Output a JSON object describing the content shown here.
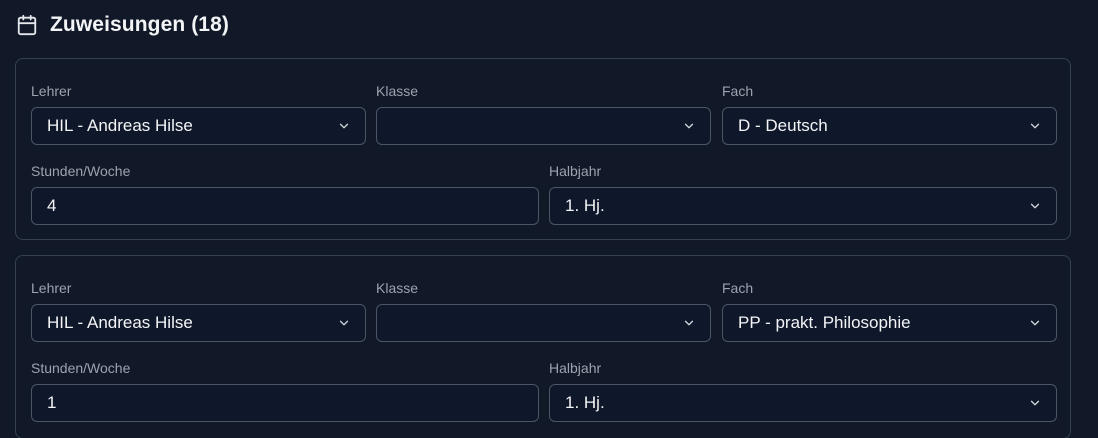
{
  "header": {
    "title": "Zuweisungen (18)",
    "icon": "calendar-icon"
  },
  "labels": {
    "teacher": "Lehrer",
    "class": "Klasse",
    "subject": "Fach",
    "hours": "Stunden/Woche",
    "semester": "Halbjahr"
  },
  "assignments": [
    {
      "teacher": "HIL - Andreas Hilse",
      "class": "",
      "subject": "D - Deutsch",
      "hours": "4",
      "semester": "1. Hj."
    },
    {
      "teacher": "HIL - Andreas Hilse",
      "class": "",
      "subject": "PP - prakt. Philosophie",
      "hours": "1",
      "semester": "1. Hj."
    }
  ],
  "colors": {
    "background": "#111827",
    "border": "#374151",
    "control_border": "#4b5563",
    "label": "#9ca3af",
    "text": "#f3f4f6"
  }
}
